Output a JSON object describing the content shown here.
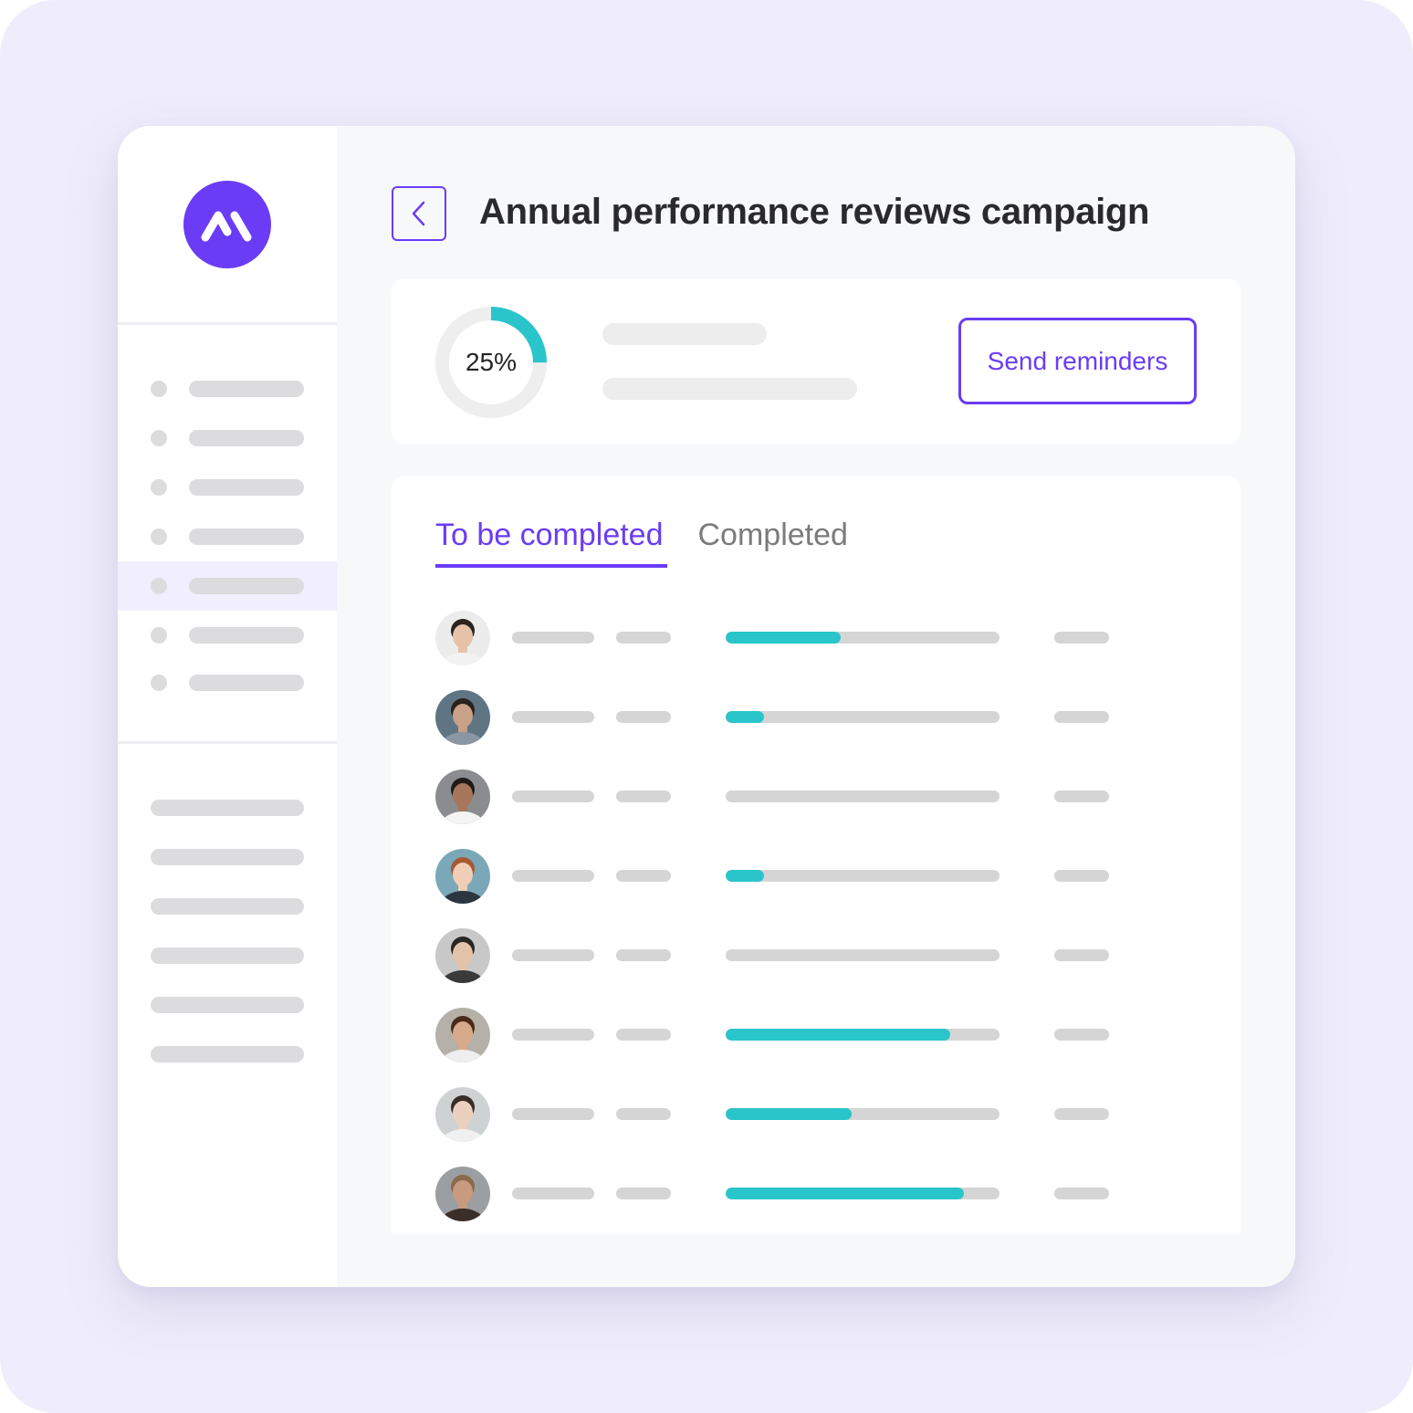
{
  "brand": {
    "logo_icon": "brand-logo-icon",
    "accent_color": "#6a3cf6",
    "progress_color": "#2ac5ca"
  },
  "sidebar": {
    "nav_items": [
      {
        "icon": "dot-icon",
        "active": false
      },
      {
        "icon": "dot-icon",
        "active": false
      },
      {
        "icon": "dot-icon",
        "active": false
      },
      {
        "icon": "dot-icon",
        "active": false
      },
      {
        "icon": "dot-icon",
        "active": true
      },
      {
        "icon": "dot-icon",
        "active": false
      },
      {
        "icon": "dot-icon",
        "active": false
      }
    ],
    "secondary_items_count": 6
  },
  "header": {
    "back_icon": "chevron-left-icon",
    "title": "Annual performance reviews campaign"
  },
  "summary": {
    "completion_percent": 25,
    "completion_label": "25%",
    "send_reminders_label": "Send reminders"
  },
  "tabs": [
    {
      "label": "To be completed",
      "active": true
    },
    {
      "label": "Completed",
      "active": false
    }
  ],
  "reviewees": [
    {
      "avatar": "avatar-woman-hair-bun",
      "progress": 0.42
    },
    {
      "avatar": "avatar-man-blue-shirt",
      "progress": 0.14
    },
    {
      "avatar": "avatar-man-smiling-white-tee",
      "progress": 0.0
    },
    {
      "avatar": "avatar-woman-red-hair",
      "progress": 0.14
    },
    {
      "avatar": "avatar-young-man-hat",
      "progress": 0.0
    },
    {
      "avatar": "avatar-man-dreadlocks",
      "progress": 0.82
    },
    {
      "avatar": "avatar-woman-dark-hair",
      "progress": 0.46
    },
    {
      "avatar": "avatar-man-short-hair",
      "progress": 0.87
    }
  ]
}
